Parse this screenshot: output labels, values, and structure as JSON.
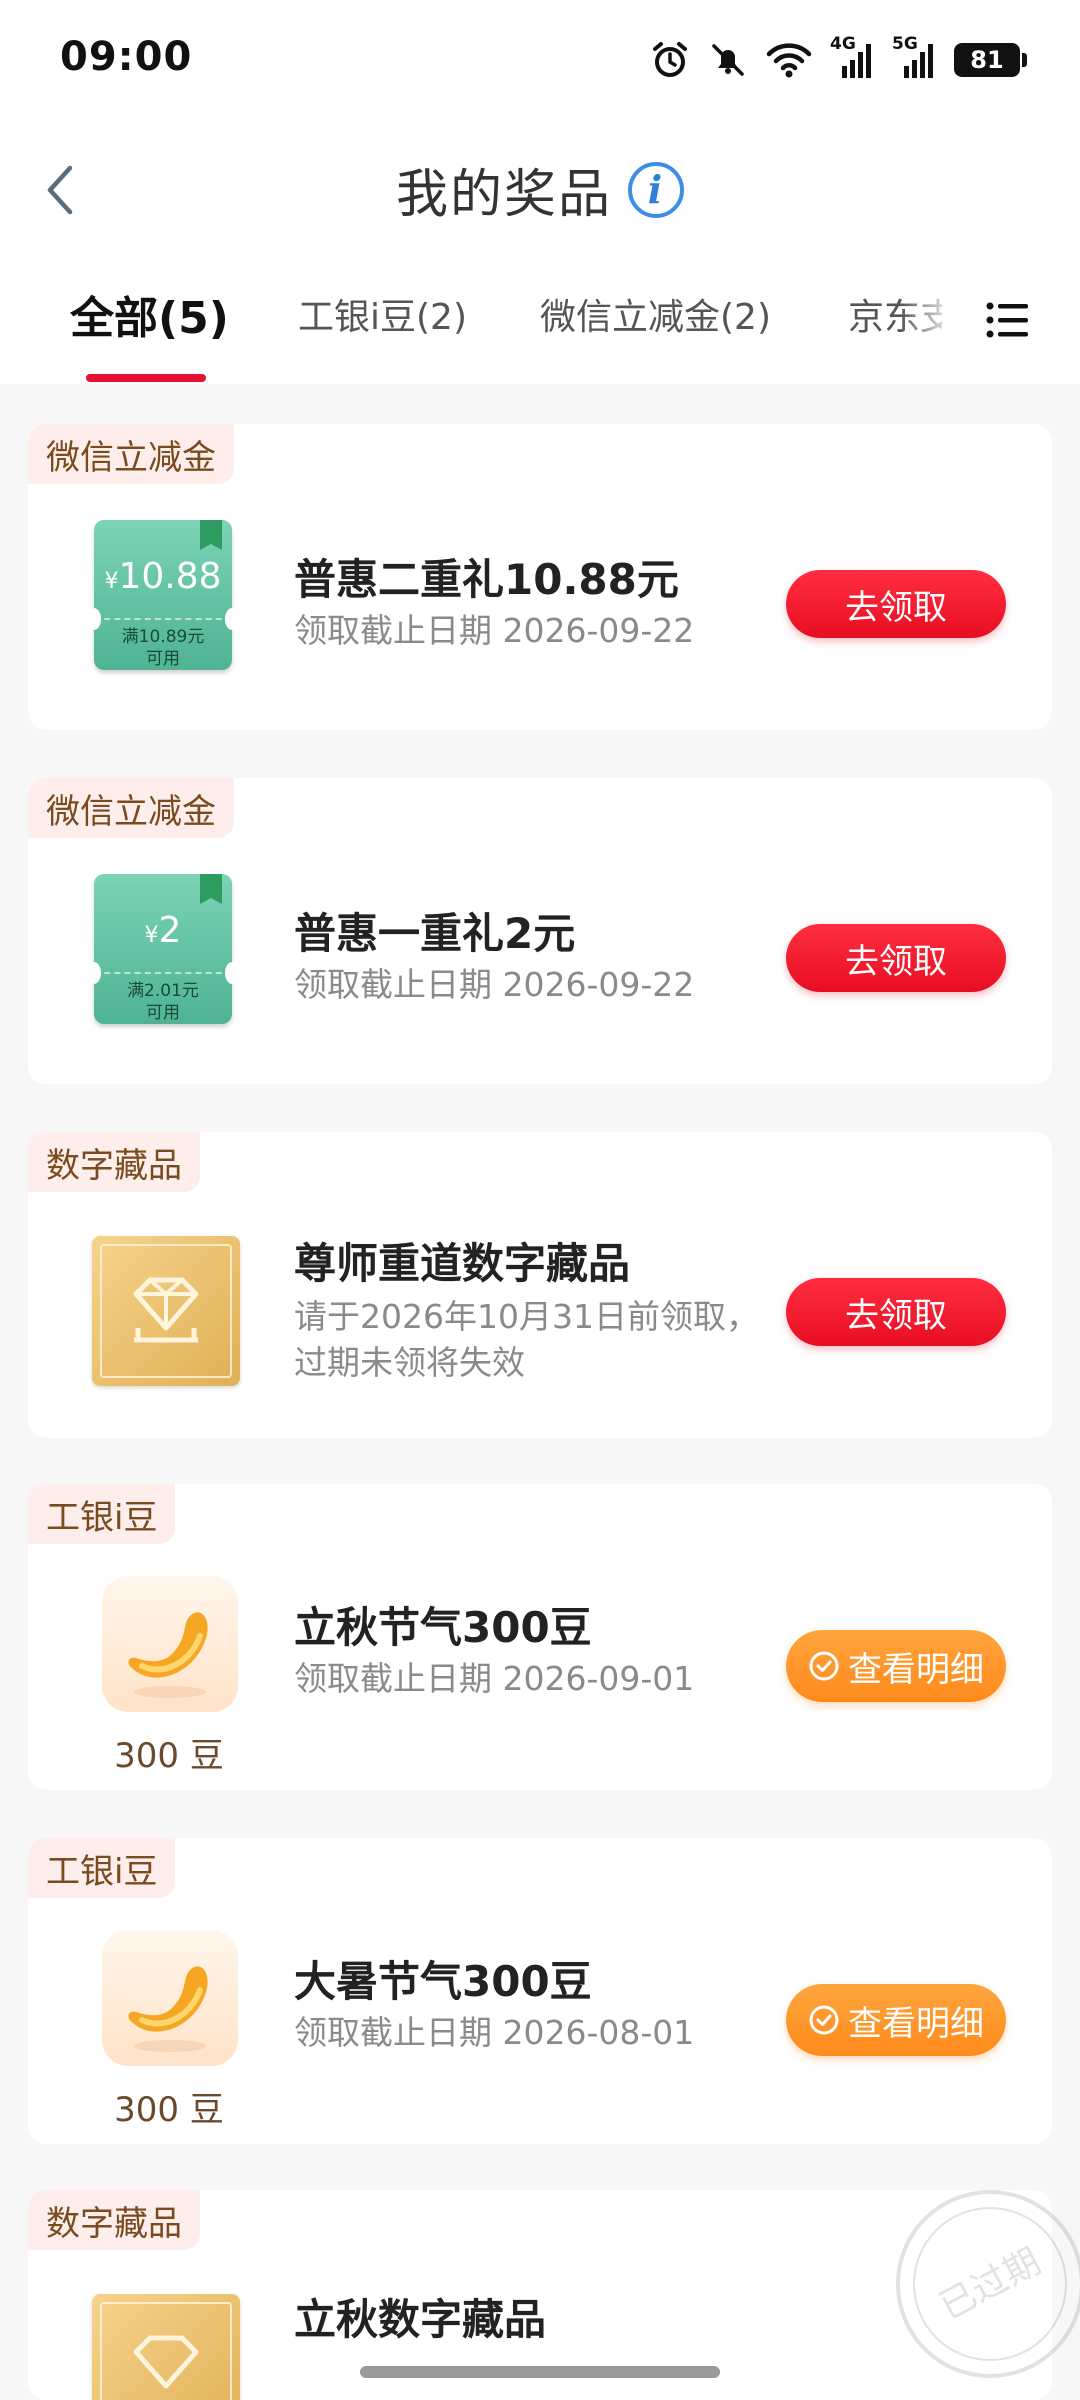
{
  "status_bar": {
    "time": "09:00",
    "net1": "4G",
    "net2": "5G",
    "battery": "81"
  },
  "header": {
    "title": "我的奖品"
  },
  "tabs": [
    {
      "label": "全部(5)",
      "active": true
    },
    {
      "label": "工银i豆(2)"
    },
    {
      "label": "微信立减金(2)"
    },
    {
      "label": "京东支"
    }
  ],
  "cards": [
    {
      "tag": "微信立减金",
      "thumb": {
        "type": "coupon",
        "currency": "¥",
        "amount": "10.88",
        "condition_line1": "满10.89元",
        "condition_line2": "可用"
      },
      "title": "普惠二重礼10.88元",
      "subtitle": "领取截止日期 2026-09-22",
      "button": "去领取"
    },
    {
      "tag": "微信立减金",
      "thumb": {
        "type": "coupon",
        "currency": "¥",
        "amount": "2",
        "condition_line1": "满2.01元",
        "condition_line2": "可用"
      },
      "title": "普惠一重礼2元",
      "subtitle": "领取截止日期 2026-09-22",
      "button": "去领取"
    },
    {
      "tag": "数字藏品",
      "thumb": {
        "type": "collectible"
      },
      "title": "尊师重道数字藏品",
      "subtitle_line1": "请于2026年10月31日前领取，",
      "subtitle_line2": "过期未领将失效",
      "button": "去领取"
    },
    {
      "tag": "工银i豆",
      "thumb": {
        "type": "bean",
        "qty": "300 豆"
      },
      "title": "立秋节气300豆",
      "subtitle": "领取截止日期 2026-09-01",
      "button": "查看明细"
    },
    {
      "tag": "工银i豆",
      "thumb": {
        "type": "bean",
        "qty": "300 豆"
      },
      "title": "大暑节气300豆",
      "subtitle": "领取截止日期 2026-08-01",
      "button": "查看明细"
    },
    {
      "tag": "数字藏品",
      "thumb": {
        "type": "collectible"
      },
      "title": "立秋数字藏品",
      "stamp": "已过期"
    }
  ],
  "colors": {
    "accent_red": "#e4112f",
    "claim_button": "#f0162c",
    "detail_button": "#ff9a2e",
    "tag_bg": "#fdeeec",
    "coupon_green": "#5dbf9f",
    "collectible_gold": "#e9bf6a"
  }
}
